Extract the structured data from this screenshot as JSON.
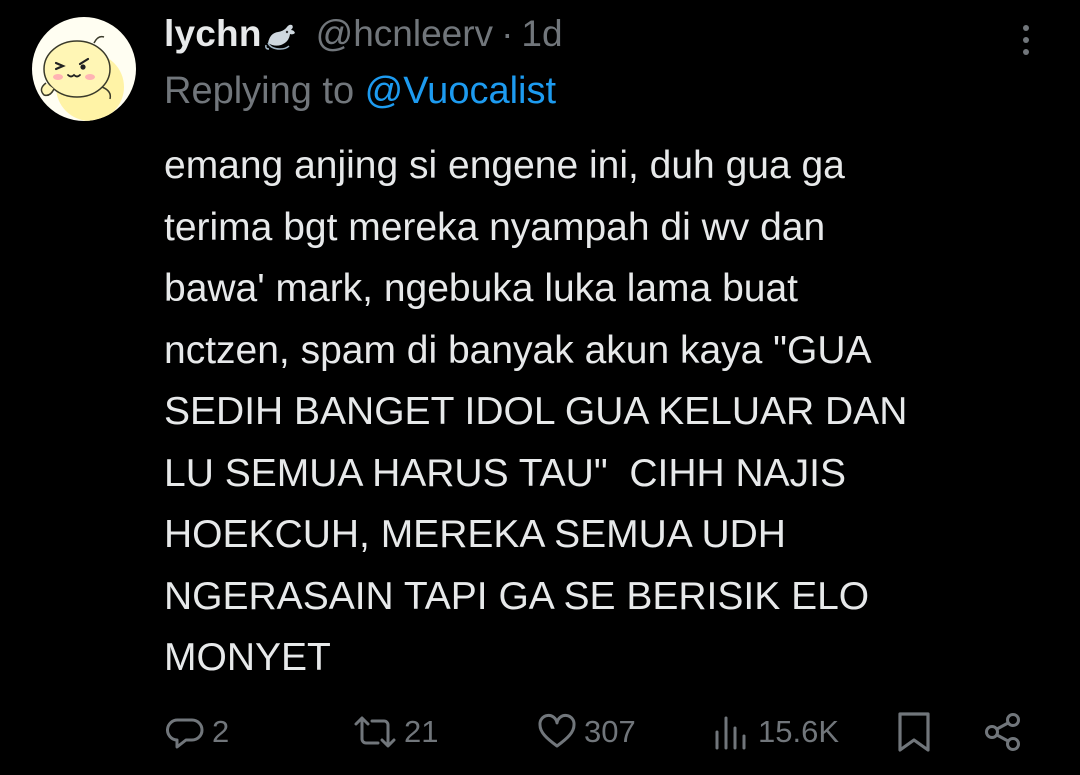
{
  "tweet": {
    "author": {
      "display_name": "lychn",
      "name_emoji_icon": "seal-icon",
      "handle": "@hcnleerv",
      "separator": "·",
      "time": "1d",
      "avatar_icon": "yellow-chick-avatar"
    },
    "reply": {
      "prefix": "Replying to ",
      "mention": "@Vuocalist"
    },
    "text_lines": [
      "emang anjing si engene ini, duh gua ga",
      "terima bgt mereka nyampah di wv dan",
      "bawa' mark, ngebuka luka lama buat",
      "nctzen, spam di banyak akun kaya \"GUA",
      "SEDIH BANGET IDOL GUA KELUAR DAN",
      "LU SEMUA HARUS TAU\"  CIHH NAJIS",
      "HOEKCUH, MEREKA SEMUA UDH",
      "NGERASAIN TAPI GA SE BERISIK ELO",
      "MONYET"
    ],
    "actions": {
      "replies": {
        "icon": "reply-icon",
        "count": "2"
      },
      "reposts": {
        "icon": "repost-icon",
        "count": "21"
      },
      "likes": {
        "icon": "heart-icon",
        "count": "307"
      },
      "views": {
        "icon": "views-icon",
        "count": "15.6K"
      },
      "bookmark": {
        "icon": "bookmark-icon"
      },
      "share": {
        "icon": "share-icon"
      }
    },
    "menu_icon": "more-vertical-icon"
  },
  "colors": {
    "background": "#000000",
    "primary_text": "#e7e9ea",
    "secondary_text": "#71767b",
    "accent": "#1d9bf0"
  }
}
